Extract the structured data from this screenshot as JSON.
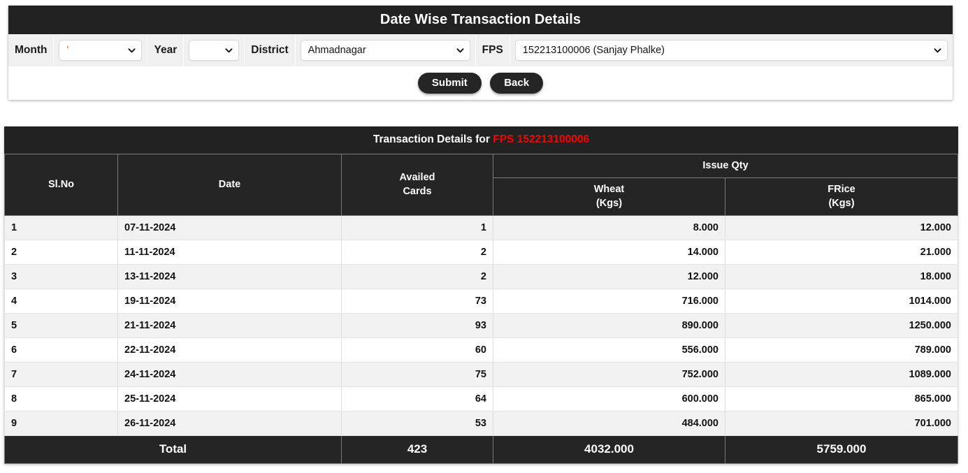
{
  "panel": {
    "title": "Date Wise Transaction Details",
    "filters": [
      {
        "label": "Month",
        "value": "'",
        "name": "month"
      },
      {
        "label": "Year",
        "value": "",
        "name": "year"
      },
      {
        "label": "District",
        "value": "Ahmadnagar",
        "name": "district"
      },
      {
        "label": "FPS",
        "value": "152213100006 (Sanjay Phalke)",
        "name": "fps"
      }
    ],
    "buttons": {
      "submit_label": "Submit",
      "back_label": "Back"
    }
  },
  "table": {
    "caption_prefix": "Transaction Details for ",
    "caption_highlight": "FPS 152213100006",
    "headers": {
      "slno": "Sl.No",
      "date": "Date",
      "availed_cards": "Availed\nCards",
      "availed_cards_line1": "Availed",
      "availed_cards_line2": "Cards",
      "issue_qty": "Issue Qty",
      "wheat_line1": "Wheat",
      "wheat_line2": "(Kgs)",
      "frice_line1": "FRice",
      "frice_line2": "(Kgs)"
    },
    "rows": [
      {
        "slno": "1",
        "date": "07-11-2024",
        "availed_cards": "1",
        "wheat": "8.000",
        "frice": "12.000"
      },
      {
        "slno": "2",
        "date": "11-11-2024",
        "availed_cards": "2",
        "wheat": "14.000",
        "frice": "21.000"
      },
      {
        "slno": "3",
        "date": "13-11-2024",
        "availed_cards": "2",
        "wheat": "12.000",
        "frice": "18.000"
      },
      {
        "slno": "4",
        "date": "19-11-2024",
        "availed_cards": "73",
        "wheat": "716.000",
        "frice": "1014.000"
      },
      {
        "slno": "5",
        "date": "21-11-2024",
        "availed_cards": "93",
        "wheat": "890.000",
        "frice": "1250.000"
      },
      {
        "slno": "6",
        "date": "22-11-2024",
        "availed_cards": "60",
        "wheat": "556.000",
        "frice": "789.000"
      },
      {
        "slno": "7",
        "date": "24-11-2024",
        "availed_cards": "75",
        "wheat": "752.000",
        "frice": "1089.000"
      },
      {
        "slno": "8",
        "date": "25-11-2024",
        "availed_cards": "64",
        "wheat": "600.000",
        "frice": "865.000"
      },
      {
        "slno": "9",
        "date": "26-11-2024",
        "availed_cards": "53",
        "wheat": "484.000",
        "frice": "701.000"
      }
    ],
    "total": {
      "label": "Total",
      "availed_cards": "423",
      "wheat": "4032.000",
      "frice": "5759.000"
    }
  },
  "colors": {
    "header_bg": "#222222",
    "row_alt_bg": "#f2f2f2",
    "highlight_red": "#ff0000",
    "filter_bar_bg": "#f0f0f0",
    "month_value_color": "#c96a10"
  },
  "icons": {
    "chevron_down": "chevron-down-icon"
  }
}
